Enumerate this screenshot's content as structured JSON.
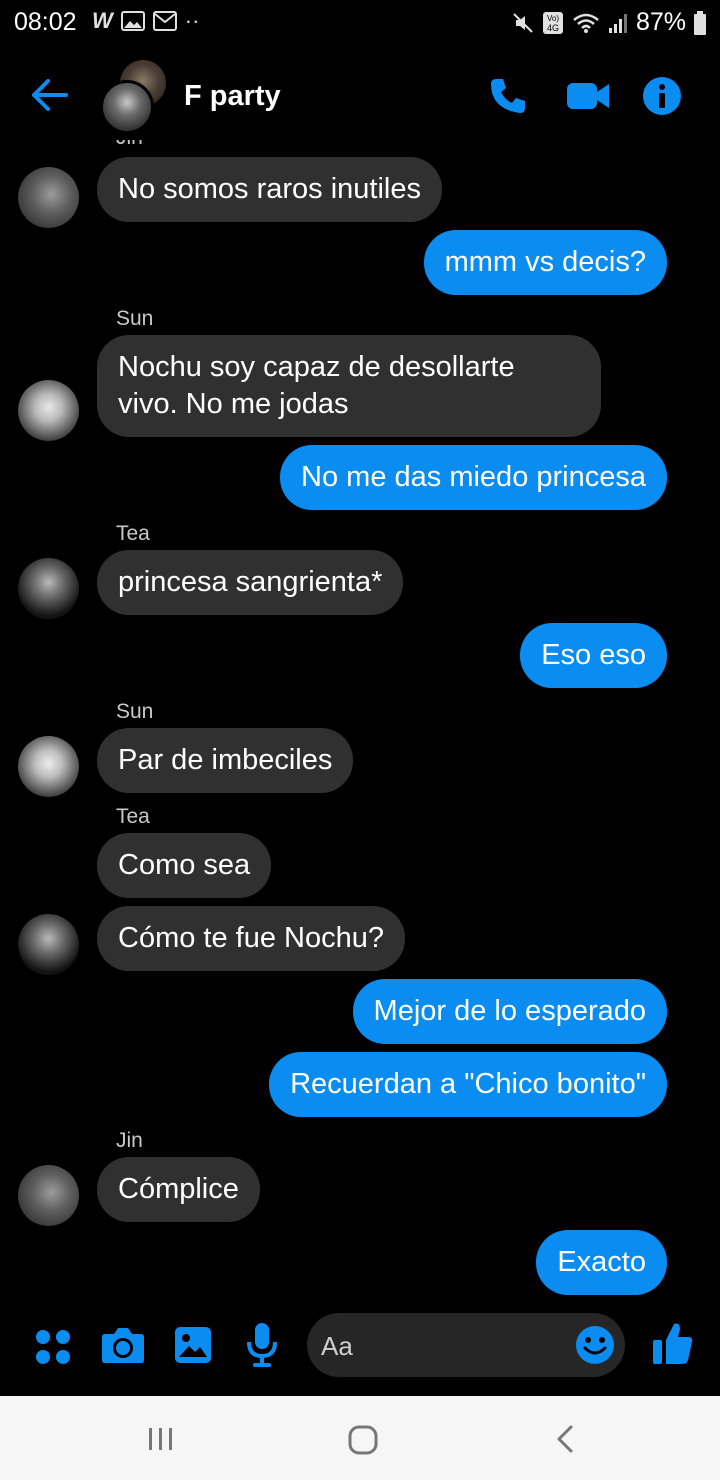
{
  "status_bar": {
    "time": "08:02",
    "battery": "87%",
    "icons": [
      "w-icon",
      "image-icon",
      "gmail-icon",
      "dots-icon",
      "mute-icon",
      "volte-icon",
      "wifi-icon",
      "signal-icon",
      "battery-icon"
    ]
  },
  "header": {
    "title": "F party",
    "icons": [
      "back-arrow-icon",
      "phone-icon",
      "video-icon",
      "info-icon"
    ]
  },
  "messages": [
    {
      "id": "m1",
      "dir": "in",
      "sender": "",
      "text": "No somos raros inutiles"
    },
    {
      "id": "m2",
      "dir": "out",
      "text": "mmm vs decis?"
    },
    {
      "id": "m3",
      "dir": "in",
      "sender": "Sun",
      "text": "Nochu soy capaz de desollarte vivo. No me jodas"
    },
    {
      "id": "m4",
      "dir": "out",
      "text": "No me das miedo princesa"
    },
    {
      "id": "m5",
      "dir": "in",
      "sender": "Tea",
      "text": "princesa sangrienta*"
    },
    {
      "id": "m6",
      "dir": "out",
      "text": "Eso eso"
    },
    {
      "id": "m7",
      "dir": "in",
      "sender": "Sun",
      "text": "Par de imbeciles"
    },
    {
      "id": "m8",
      "dir": "in",
      "sender": "Tea",
      "text": "Como sea"
    },
    {
      "id": "m9",
      "dir": "in",
      "sender": "",
      "text": "Cómo te fue Nochu?"
    },
    {
      "id": "m10",
      "dir": "out",
      "text": "Mejor de lo esperado"
    },
    {
      "id": "m11",
      "dir": "out",
      "text": "Recuerdan a \"Chico bonito\""
    },
    {
      "id": "m12",
      "dir": "in",
      "sender": "Jin",
      "text": "Cómplice"
    },
    {
      "id": "m13",
      "dir": "out",
      "text": "Exacto"
    }
  ],
  "composer": {
    "placeholder": "Aa",
    "icons": [
      "apps-icon",
      "camera-icon",
      "gallery-icon",
      "mic-icon",
      "emoji-icon",
      "thumbs-up-icon"
    ]
  },
  "nav_bar": {
    "icons": [
      "recents-icon",
      "home-icon",
      "back-icon"
    ]
  },
  "colors": {
    "accent": "#0a8cf0",
    "incoming_bubble": "#303030",
    "background": "#000000"
  }
}
